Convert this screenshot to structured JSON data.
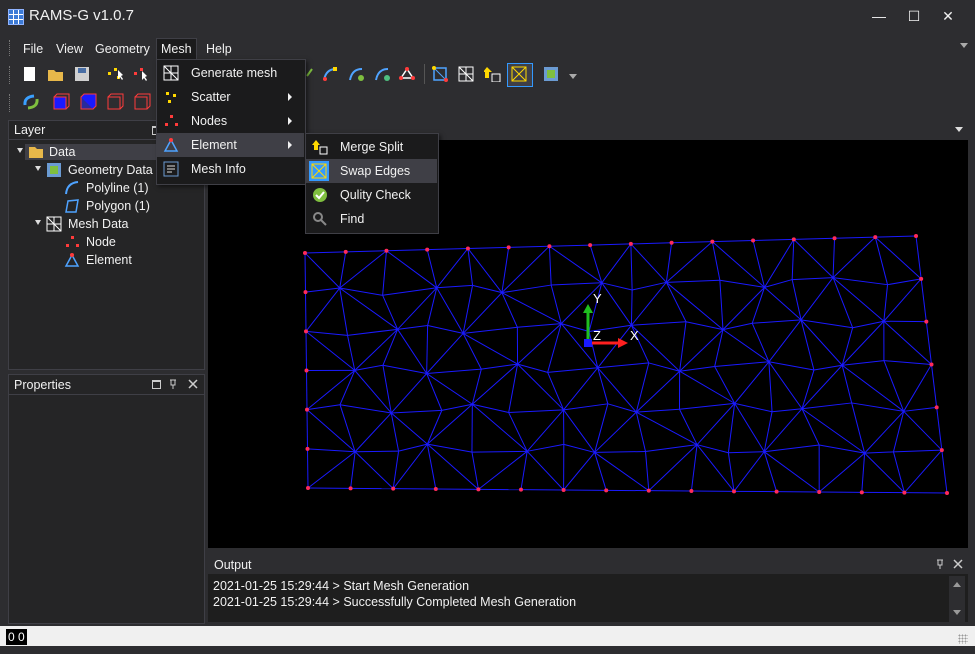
{
  "app": {
    "title": "RAMS-G v1.0.7"
  },
  "window_controls": {
    "minimize": "—",
    "maximize": "☐",
    "close": "✕"
  },
  "menubar": {
    "file": "File",
    "view": "View",
    "geometry": "Geometry",
    "mesh": "Mesh",
    "help": "Help"
  },
  "mesh_menu": {
    "generate_mesh": "Generate mesh",
    "scatter": "Scatter",
    "nodes": "Nodes",
    "element": "Element",
    "mesh_info": "Mesh Info"
  },
  "element_submenu": {
    "merge_split": "Merge Split",
    "swap_edges": "Swap Edges",
    "quality_check": "Qulity Check",
    "find": "Find"
  },
  "layer_panel": {
    "title": "Layer",
    "tree": {
      "data": "Data",
      "geometry_data": "Geometry Data",
      "polyline": "Polyline (1)",
      "polygon": "Polygon (1)",
      "mesh_data": "Mesh Data",
      "node": "Node",
      "element": "Element"
    }
  },
  "properties_panel": {
    "title": "Properties"
  },
  "viewport": {
    "axis_labels": {
      "x": "X",
      "y": "Y",
      "z": "Z"
    },
    "colors": {
      "mesh_edge": "#1a1aff",
      "node": "#ff2a5a",
      "background": "#000000"
    }
  },
  "output_panel": {
    "title": "Output",
    "lines": [
      "2021-01-25 15:29:44 > Start Mesh Generation",
      "2021-01-25 15:29:44 > Successfully Completed Mesh Generation"
    ]
  },
  "statusbar": {
    "coordinates": "0 0"
  }
}
